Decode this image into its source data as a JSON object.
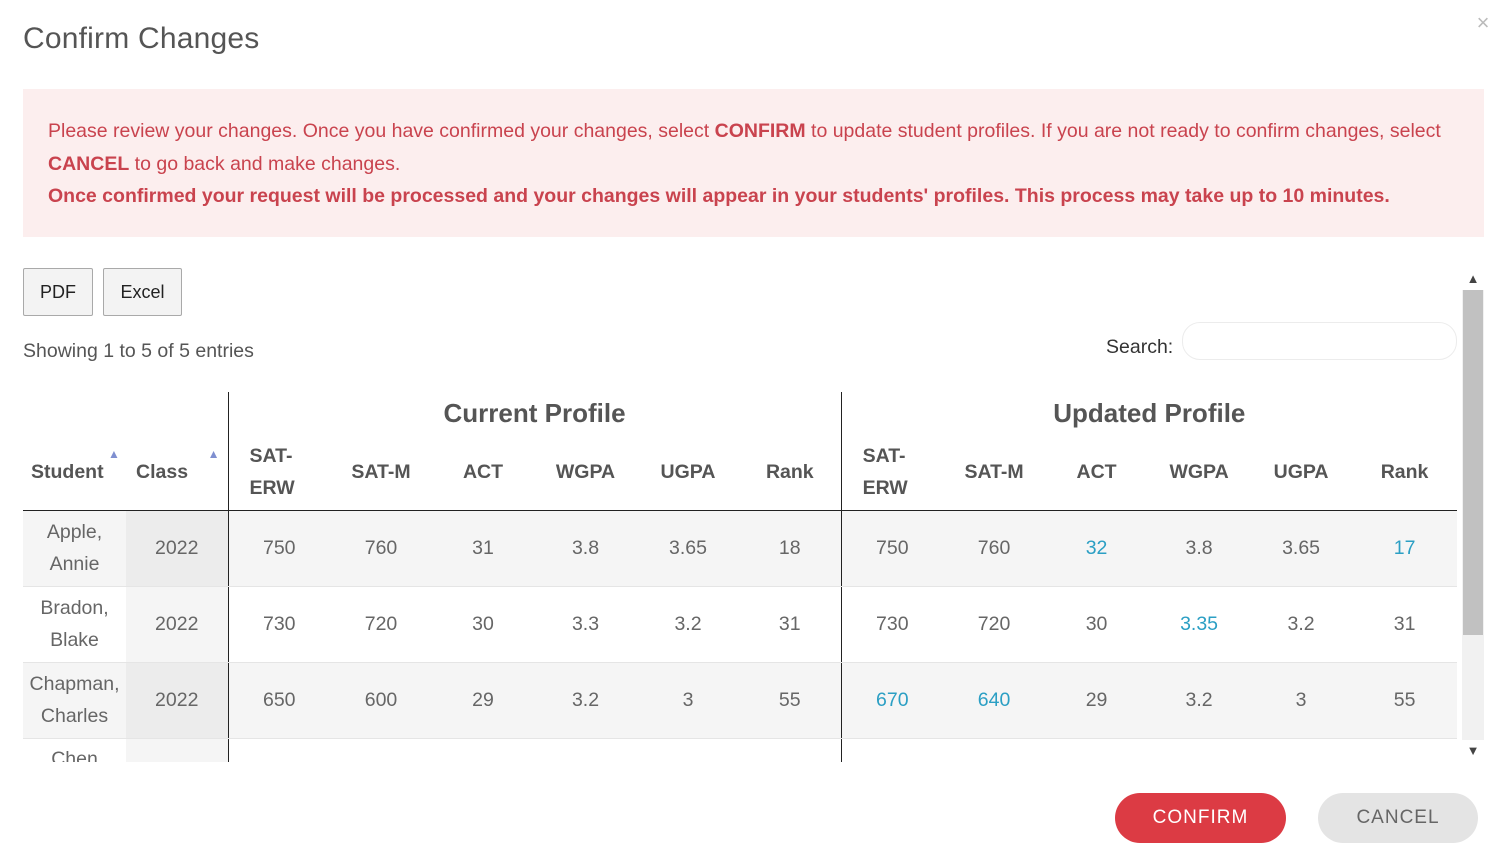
{
  "modal": {
    "title": "Confirm Changes",
    "close_glyph": "×"
  },
  "alert": {
    "line1_a": "Please review your changes. Once you have confirmed your changes, select ",
    "line1_confirm": "CONFIRM",
    "line1_b": " to update student profiles. If you are not ready to confirm changes, select ",
    "line1_cancel": "CANCEL",
    "line1_c": " to go back and make changes.",
    "line2": "Once confirmed your request will be processed and your changes will appear in your students' profiles. This process may take up to 10 minutes.",
    "color": "#c9434e",
    "background": "#fceeee"
  },
  "toolbar": {
    "pdf_label": "PDF",
    "excel_label": "Excel"
  },
  "table_info": "Showing 1 to 5 of 5 entries",
  "search": {
    "label": "Search:",
    "value": "",
    "placeholder": ""
  },
  "table": {
    "group_headers": {
      "current": "Current Profile",
      "updated": "Updated Profile"
    },
    "columns": {
      "student": "Student",
      "class": "Class",
      "sat_erw": "SAT-ERW",
      "sat_m": "SAT-M",
      "act": "ACT",
      "wgpa": "WGPA",
      "ugpa": "UGPA",
      "rank": "Rank"
    },
    "rows": [
      {
        "student": "Apple, Annie",
        "class": "2022",
        "current": {
          "sat_erw": "750",
          "sat_m": "760",
          "act": "31",
          "wgpa": "3.8",
          "ugpa": "3.65",
          "rank": "18"
        },
        "updated": {
          "sat_erw": "750",
          "sat_m": "760",
          "act": "32",
          "wgpa": "3.8",
          "ugpa": "3.65",
          "rank": "17"
        }
      },
      {
        "student": "Bradon, Blake",
        "class": "2022",
        "current": {
          "sat_erw": "730",
          "sat_m": "720",
          "act": "30",
          "wgpa": "3.3",
          "ugpa": "3.2",
          "rank": "31"
        },
        "updated": {
          "sat_erw": "730",
          "sat_m": "720",
          "act": "30",
          "wgpa": "3.35",
          "ugpa": "3.2",
          "rank": "31"
        }
      },
      {
        "student": "Chapman, Charles",
        "class": "2022",
        "current": {
          "sat_erw": "650",
          "sat_m": "600",
          "act": "29",
          "wgpa": "3.2",
          "ugpa": "3",
          "rank": "55"
        },
        "updated": {
          "sat_erw": "670",
          "sat_m": "640",
          "act": "29",
          "wgpa": "3.2",
          "ugpa": "3",
          "rank": "55"
        }
      },
      {
        "student": "Chen",
        "class": "",
        "current": {
          "sat_erw": "",
          "sat_m": "",
          "act": "",
          "wgpa": "",
          "ugpa": "",
          "rank": ""
        },
        "updated": {
          "sat_erw": "",
          "sat_m": "",
          "act": "",
          "wgpa": "",
          "ugpa": "",
          "rank": ""
        }
      }
    ],
    "changed_color": "#2b9fc4"
  },
  "icons": {
    "sort_student": "sort-asc-icon",
    "sort_class": "sort-asc-icon",
    "scroll_up": "chevron-up-icon",
    "scroll_down": "chevron-down-icon"
  },
  "footer": {
    "confirm_label": "CONFIRM",
    "cancel_label": "CANCEL",
    "confirm_color": "#dc3b44"
  }
}
